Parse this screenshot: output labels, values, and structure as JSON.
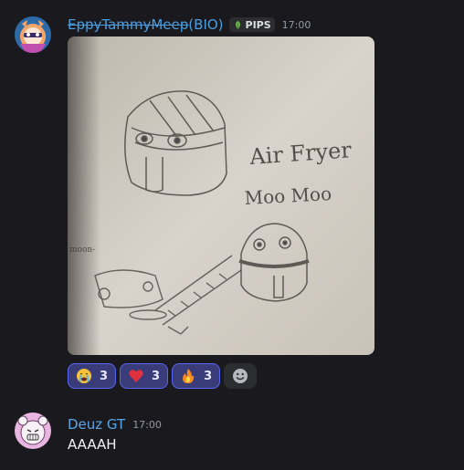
{
  "messages": [
    {
      "author_strike": "EppyTammyMeep",
      "author_suffix": "(BIO)",
      "tag": "PIPS",
      "time": "17:00",
      "sketch_text": {
        "line1": "Air Fryer",
        "line2": "Moo Moo",
        "small": "moon-"
      },
      "reactions": [
        {
          "emoji": "crying-face-icon",
          "count": "3"
        },
        {
          "emoji": "red-heart-icon",
          "count": "3"
        },
        {
          "emoji": "fire-icon",
          "count": "3"
        }
      ]
    },
    {
      "author": "Deuz GT",
      "time": "17:00",
      "text": "AAAAH"
    }
  ],
  "colors": {
    "background": "#1a1a1e",
    "username_link": "#4a9ee0",
    "reaction_active_bg": "#3a3c7a",
    "reaction_active_border": "#5865f2"
  }
}
